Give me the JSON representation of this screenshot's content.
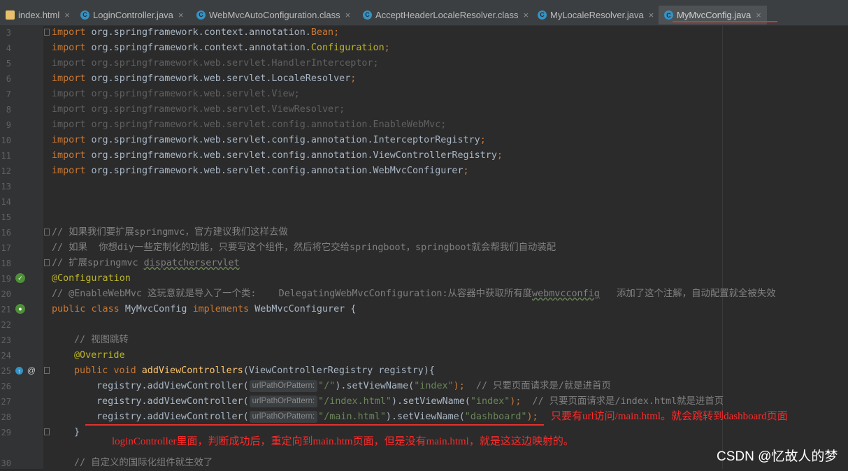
{
  "tabs": [
    {
      "label": "index.html",
      "icon": "html-file-icon"
    },
    {
      "label": "LoginController.java",
      "icon": "java-class-icon"
    },
    {
      "label": "WebMvcAutoConfiguration.class",
      "icon": "java-class-icon"
    },
    {
      "label": "AcceptHeaderLocaleResolver.class",
      "icon": "java-class-icon"
    },
    {
      "label": "MyLocaleResolver.java",
      "icon": "java-class-icon"
    },
    {
      "label": "MyMvcConfig.java",
      "icon": "java-class-icon",
      "active": true
    }
  ],
  "tab_close_glyph": "×",
  "tab_icon_letter": "C",
  "line_numbers": [
    "3",
    "4",
    "5",
    "6",
    "7",
    "8",
    "9",
    "10",
    "11",
    "12",
    "13",
    "14",
    "15",
    "16",
    "17",
    "18",
    "19",
    "20",
    "21",
    "22",
    "23",
    "24",
    "25",
    "26",
    "27",
    "28",
    "29",
    "30"
  ],
  "code": {
    "import_kw": "import",
    "imports": [
      {
        "pkg": "org.springframework.context.annotation.",
        "cls": "Bean",
        "used": true
      },
      {
        "pkg": "org.springframework.context.annotation.",
        "cls": "Configuration",
        "used": true
      },
      {
        "pkg": "org.springframework.web.servlet.",
        "cls": "HandlerInterceptor",
        "used": false
      },
      {
        "pkg": "org.springframework.web.servlet.",
        "cls": "LocaleResolver",
        "used": true
      },
      {
        "pkg": "org.springframework.web.servlet.",
        "cls": "View",
        "used": false
      },
      {
        "pkg": "org.springframework.web.servlet.",
        "cls": "ViewResolver",
        "used": false
      },
      {
        "pkg": "org.springframework.web.servlet.config.annotation.",
        "cls": "EnableWebMvc",
        "used": false
      },
      {
        "pkg": "org.springframework.web.servlet.config.annotation.",
        "cls": "InterceptorRegistry",
        "used": true
      },
      {
        "pkg": "org.springframework.web.servlet.config.annotation.",
        "cls": "ViewControllerRegistry",
        "used": true
      },
      {
        "pkg": "org.springframework.web.servlet.config.annotation.",
        "cls": "WebMvcConfigurer",
        "used": true
      }
    ],
    "comment1": "// 如果我们要扩展springmvc，官方建议我们这样去做",
    "comment2": "// 如果  你想diy一些定制化的功能，只要写这个组件，然后将它交给springboot，springboot就会帮我们自动装配",
    "comment3_prefix": "// 扩展springmvc ",
    "comment3_word": "dispatcherservlet",
    "annotation_config": "@Configuration",
    "comment4_prefix": "// @EnableWebMvc 这玩意就是导入了一个类:    DelegatingWebMvcConfiguration:从容器中获取所有度",
    "comment4_word": "webmvcconfig",
    "comment4_suffix": "   添加了这个注解，自动配置就全被失效",
    "class_decl": {
      "kw1": "public",
      "kw2": "class",
      "name": "MyMvcConfig",
      "kw3": "implements",
      "iface": "WebMvcConfigurer",
      "brace": "{"
    },
    "comment5": "// 视图跳转",
    "override": "@Override",
    "method_decl": {
      "kw1": "public",
      "kw2": "void",
      "name": "addViewControllers",
      "params": "(ViewControllerRegistry registry){"
    },
    "calls": [
      {
        "prefix": "registry.addViewController(",
        "hint": "urlPathOrPattern:",
        "path": "\"/\"",
        "mid": ").setViewName(",
        "view": "\"index\"",
        "end": ");",
        "comment": "  // 只要页面请求是/就是进首页"
      },
      {
        "prefix": "registry.addViewController(",
        "hint": "urlPathOrPattern:",
        "path": "\"/index.html\"",
        "mid": ").setViewName(",
        "view": "\"index\"",
        "end": ");",
        "comment": "  // 只要页面请求是/index.html就是进首页"
      },
      {
        "prefix": "registry.addViewController(",
        "hint": "urlPathOrPattern:",
        "path": "\"/main.html\"",
        "mid": ").setViewName(",
        "view": "\"dashboard\"",
        "end": ");",
        "comment": ""
      }
    ],
    "close_brace": "}",
    "comment6": "// 自定义的国际化组件就生效了"
  },
  "annotations": {
    "note_line28": "只要有url访问/main.html。就会跳转到dashboard页面",
    "note_line29": "loginController里面，判断成功后，重定向到main.htm页面，但是没有main.html，就是这这边映射的。",
    "color": "#e0312d"
  },
  "watermark": "CSDN @忆故人的梦"
}
